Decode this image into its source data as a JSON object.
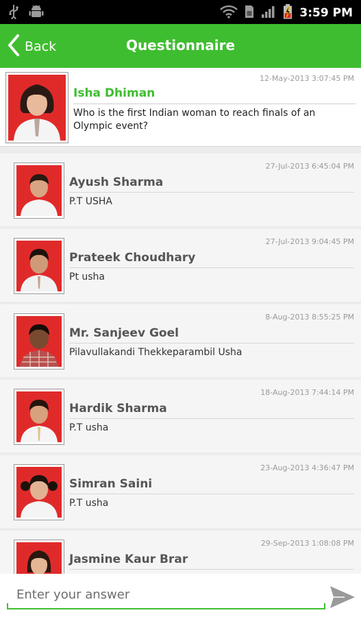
{
  "status_bar": {
    "time": "3:59 PM",
    "icons": [
      "usb-icon",
      "android-debug-icon",
      "wifi-icon",
      "sim-icon",
      "signal-icon",
      "battery-charging-icon"
    ]
  },
  "app_bar": {
    "back_label": "Back",
    "title": "Questionnaire",
    "accent_color": "#3fbd30"
  },
  "question": {
    "author": "Isha  Dhiman",
    "date": "12-May-2013 3:07:45 PM",
    "text": "Who is the first Indian woman to reach finals of an Olympic event?"
  },
  "answers": [
    {
      "name": "Ayush  Sharma",
      "date": "27-Jul-2013 6:45:04 PM",
      "text": "P.T USHA"
    },
    {
      "name": "Prateek  Choudhary",
      "date": "27-Jul-2013 9:04:45 PM",
      "text": "Pt usha"
    },
    {
      "name": "Mr. Sanjeev Goel",
      "date": "8-Aug-2013 8:55:25 PM",
      "text": "Pilavullakandi Thekkeparambil Usha"
    },
    {
      "name": "Hardik  Sharma",
      "date": "18-Aug-2013 7:44:14 PM",
      "text": "P.T usha"
    },
    {
      "name": "Simran  Saini",
      "date": "23-Aug-2013 4:36:47 PM",
      "text": "P.T usha"
    },
    {
      "name": "Jasmine Kaur Brar",
      "date": "29-Sep-2013 1:08:08 PM",
      "text": ""
    }
  ],
  "input": {
    "placeholder": "Enter your answer",
    "value": ""
  }
}
